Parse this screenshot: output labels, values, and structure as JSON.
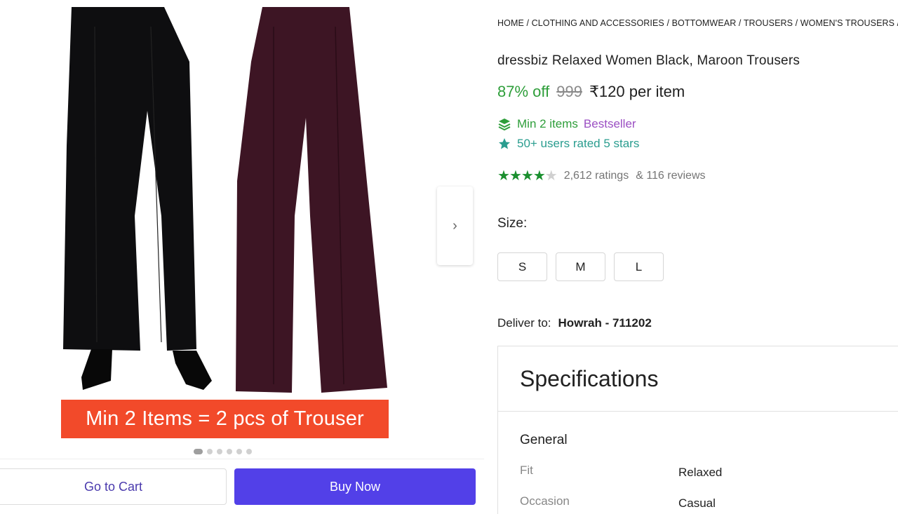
{
  "gallery": {
    "promo_text": "Min 2 Items = 2 pcs of Trouser",
    "next_icon": "›",
    "dot_count": 6,
    "active_dot": 0
  },
  "actions": {
    "cart_label": "Go to Cart",
    "buy_label": "Buy Now"
  },
  "breadcrumb": "HOME / CLOTHING AND ACCESSORIES / BOTTOMWEAR / TROUSERS / WOMEN'S TROUSERS /",
  "product": {
    "title": "dressbiz Relaxed Women Black, Maroon Trousers",
    "discount": "87% off",
    "mrp": "999",
    "price": "₹120 per item",
    "min_items": "Min 2 items",
    "bestseller": "Bestseller",
    "users_rated": "50+ users rated 5 stars",
    "rating_stars": 4,
    "ratings_text": "2,612 ratings",
    "reviews_text": "& 116 reviews"
  },
  "size": {
    "label": "Size:",
    "options": [
      "S",
      "M",
      "L"
    ]
  },
  "delivery": {
    "label": "Deliver to:",
    "location": "Howrah - 711202"
  },
  "specs": {
    "title": "Specifications",
    "group": "General",
    "rows": [
      {
        "key": "Fit",
        "value": "Relaxed"
      },
      {
        "key": "Occasion",
        "value": "Casual"
      }
    ]
  },
  "colors": {
    "accent": "#5240e8",
    "green": "#2e9e3a",
    "promo": "#f24a2a",
    "pant_black": "#0e0e10",
    "pant_maroon": "#3d1524"
  }
}
